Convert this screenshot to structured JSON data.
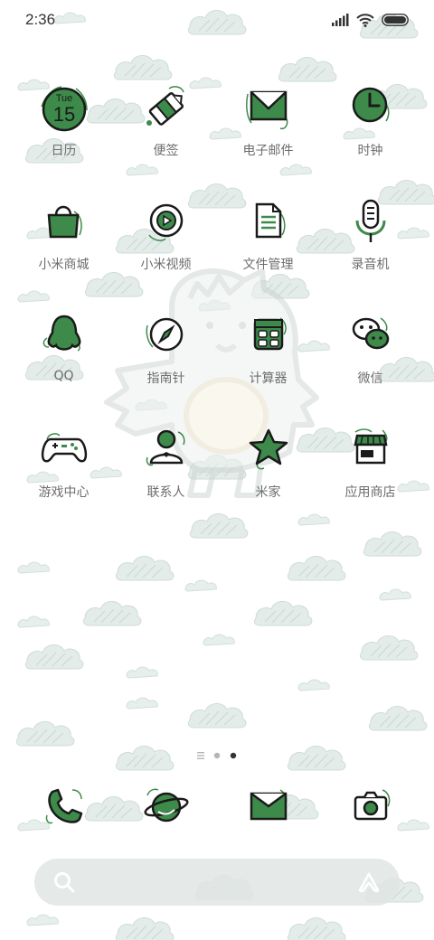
{
  "status_bar": {
    "time": "2:36",
    "icons": [
      "signal-icon",
      "wifi-icon",
      "battery-icon"
    ]
  },
  "apps": [
    {
      "label": "日历",
      "icon": "calendar-icon",
      "calendar_day": "Tue",
      "calendar_date": "15"
    },
    {
      "label": "便签",
      "icon": "notes-tag-icon"
    },
    {
      "label": "电子邮件",
      "icon": "email-icon"
    },
    {
      "label": "时钟",
      "icon": "clock-icon"
    },
    {
      "label": "小米商城",
      "icon": "shopping-bag-icon"
    },
    {
      "label": "小米视频",
      "icon": "video-play-icon"
    },
    {
      "label": "文件管理",
      "icon": "file-icon"
    },
    {
      "label": "录音机",
      "icon": "microphone-icon"
    },
    {
      "label": "QQ",
      "icon": "qq-penguin-icon"
    },
    {
      "label": "指南针",
      "icon": "compass-icon"
    },
    {
      "label": "计算器",
      "icon": "calculator-icon"
    },
    {
      "label": "微信",
      "icon": "wechat-icon"
    },
    {
      "label": "游戏中心",
      "icon": "gamepad-icon"
    },
    {
      "label": "联系人",
      "icon": "contact-person-icon"
    },
    {
      "label": "米家",
      "icon": "star-icon"
    },
    {
      "label": "应用商店",
      "icon": "app-store-icon"
    }
  ],
  "page_indicator": {
    "pages": 3,
    "active": 2,
    "first_is_list": true
  },
  "dock": [
    {
      "icon": "phone-icon"
    },
    {
      "icon": "browser-planet-icon"
    },
    {
      "icon": "messages-icon"
    },
    {
      "icon": "camera-icon"
    }
  ],
  "search_bar": {
    "left_icon": "search-icon",
    "right_icon": "xiaoai-assistant-icon"
  },
  "colors": {
    "accent_green": "#3d8a4a",
    "outline": "#1a1a1a",
    "label": "#6d6d6d",
    "cloud": "#dfe9e6"
  }
}
